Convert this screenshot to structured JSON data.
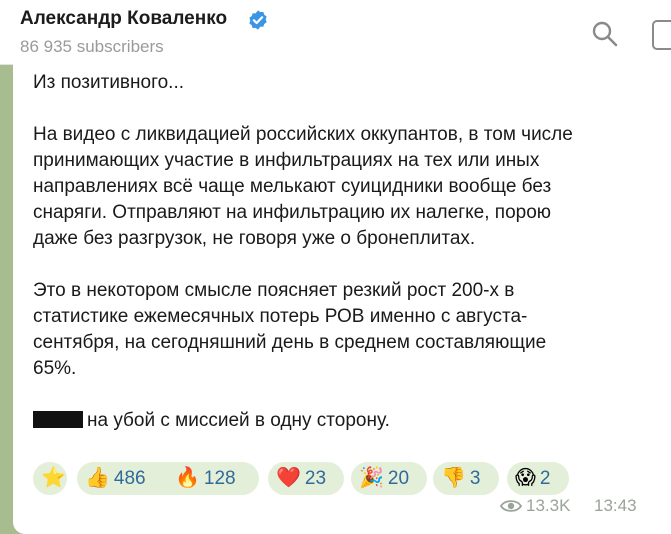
{
  "header": {
    "channel_name": "Александр Коваленко",
    "subscribers": "86 935 subscribers"
  },
  "message": {
    "paragraphs": [
      "Из позитивного...",
      "На видео с ликвидацией российских оккупантов, в том числе\nпринимающих участие в инфильтрациях на тех или иных\nнаправлениях всё чаще мелькают суицидники вообще без\nснаряги. Отправляют на инфильтрацию их налегке, порою\nдаже без разгрузок, не говоря уже о бронеплитах.",
      "Это в некотором смысле поясняет резкий рост 200-х в\nстатистике ежемесячных потерь РОВ именно с августа-\nсентября, на сегодняшний день в среднем составляющие\n65%."
    ],
    "last_line": "на убой с миссией в одну сторону."
  },
  "reactions": [
    {
      "emoji": "⭐",
      "count": ""
    },
    {
      "emoji": "👍",
      "count": "486"
    },
    {
      "emoji": "🔥",
      "count": "128"
    },
    {
      "emoji": "❤️",
      "count": "23"
    },
    {
      "emoji": "🎉",
      "count": "20"
    },
    {
      "emoji": "👎",
      "count": "3"
    },
    {
      "emoji": "😱",
      "count": "2"
    }
  ],
  "meta": {
    "views": "13.3K",
    "time": "13:43"
  },
  "icons": {
    "verified": "verified-badge-icon",
    "search": "search-icon",
    "views": "eye-icon"
  },
  "colors": {
    "accent": "#2f6b9a",
    "verified": "#3a95e6",
    "background": "#a8bd8f"
  }
}
